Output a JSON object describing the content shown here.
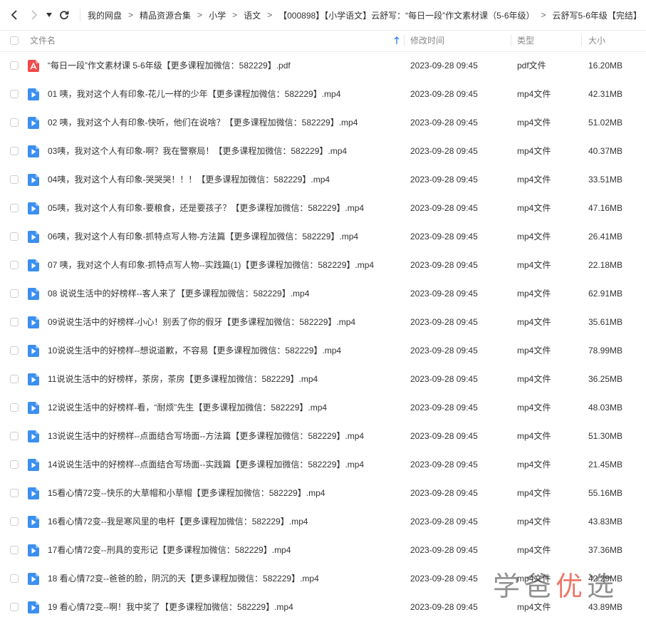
{
  "toolbar": {
    "breadcrumbs": [
      "我的网盘",
      "精品资源合集",
      "小学",
      "语文",
      "【000898】【小学语文】云舒写：“每日一段”作文素材课（5-6年级）",
      "云舒写5-6年级【完结】"
    ],
    "separator": ">"
  },
  "table": {
    "headers": {
      "name": "文件名",
      "modified": "修改时间",
      "type": "类型",
      "size": "大小"
    },
    "rows": [
      {
        "name": "“每日一段”作文素材课 5-6年级【更多课程加微信：582229】.pdf",
        "date": "2023-09-28 09:45",
        "type": "pdf文件",
        "size": "16.20MB",
        "icon": "pdf-icon"
      },
      {
        "name": "01 咦，我对这个人有印象-花儿一样的少年【更多课程加微信：582229】.mp4",
        "date": "2023-09-28 09:45",
        "type": "mp4文件",
        "size": "42.31MB",
        "icon": "video-icon"
      },
      {
        "name": "02 咦，我对这个人有印象-快听，他们在说啥？【更多课程加微信：582229】.mp4",
        "date": "2023-09-28 09:45",
        "type": "mp4文件",
        "size": "51.02MB",
        "icon": "video-icon"
      },
      {
        "name": "03咦，我对这个人有印象-啊？我在警察局！【更多课程加微信：582229】.mp4",
        "date": "2023-09-28 09:45",
        "type": "mp4文件",
        "size": "40.37MB",
        "icon": "video-icon"
      },
      {
        "name": "04咦，我对这个人有印象-哭哭哭！！！【更多课程加微信：582229】.mp4",
        "date": "2023-09-28 09:45",
        "type": "mp4文件",
        "size": "33.51MB",
        "icon": "video-icon"
      },
      {
        "name": "05咦，我对这个人有印象-要粮食，还是要孩子？【更多课程加微信：582229】.mp4",
        "date": "2023-09-28 09:45",
        "type": "mp4文件",
        "size": "47.16MB",
        "icon": "video-icon"
      },
      {
        "name": "06咦，我对这个人有印象-抓特点写人物-方法篇【更多课程加微信：582229】.mp4",
        "date": "2023-09-28 09:45",
        "type": "mp4文件",
        "size": "26.41MB",
        "icon": "video-icon"
      },
      {
        "name": "07 咦，我对这个人有印象-抓特点写人物--实践篇(1)【更多课程加微信：582229】.mp4",
        "date": "2023-09-28 09:45",
        "type": "mp4文件",
        "size": "22.18MB",
        "icon": "video-icon"
      },
      {
        "name": "08 说说生活中的好榜样--客人来了【更多课程加微信：582229】.mp4",
        "date": "2023-09-28 09:45",
        "type": "mp4文件",
        "size": "62.91MB",
        "icon": "video-icon"
      },
      {
        "name": "09说说生活中的好榜样-小心！别丢了你的假牙【更多课程加微信：582229】.mp4",
        "date": "2023-09-28 09:45",
        "type": "mp4文件",
        "size": "35.61MB",
        "icon": "video-icon"
      },
      {
        "name": "10说说生活中的好榜样--想说道歉，不容易【更多课程加微信：582229】.mp4",
        "date": "2023-09-28 09:45",
        "type": "mp4文件",
        "size": "78.99MB",
        "icon": "video-icon"
      },
      {
        "name": "11说说生活中的好榜样，茶房，茶房【更多课程加微信：582229】.mp4",
        "date": "2023-09-28 09:45",
        "type": "mp4文件",
        "size": "36.25MB",
        "icon": "video-icon"
      },
      {
        "name": "12说说生活中的好榜样-看，“耐烦”先生【更多课程加微信：582229】.mp4",
        "date": "2023-09-28 09:45",
        "type": "mp4文件",
        "size": "48.03MB",
        "icon": "video-icon"
      },
      {
        "name": "13说说生活中的好榜样--点面结合写场面--方法篇【更多课程加微信：582229】.mp4",
        "date": "2023-09-28 09:45",
        "type": "mp4文件",
        "size": "51.30MB",
        "icon": "video-icon"
      },
      {
        "name": "14说说生活中的好榜样--点面结合写场面--实践篇【更多课程加微信：582229】.mp4",
        "date": "2023-09-28 09:45",
        "type": "mp4文件",
        "size": "21.45MB",
        "icon": "video-icon"
      },
      {
        "name": "15看心情72变--快乐的大草帽和小草帽【更多课程加微信：582229】.mp4",
        "date": "2023-09-28 09:45",
        "type": "mp4文件",
        "size": "55.16MB",
        "icon": "video-icon"
      },
      {
        "name": "16看心情72变--我是寒风里的电杆【更多课程加微信：582229】.mp4",
        "date": "2023-09-28 09:45",
        "type": "mp4文件",
        "size": "43.83MB",
        "icon": "video-icon"
      },
      {
        "name": "17看心情72变--刑具的变形记【更多课程加微信：582229】.mp4",
        "date": "2023-09-28 09:45",
        "type": "mp4文件",
        "size": "37.36MB",
        "icon": "video-icon"
      },
      {
        "name": "18 看心情72变--爸爸的脸，阴沉的天【更多课程加微信：582229】.mp4",
        "date": "2023-09-28 09:45",
        "type": "mp4文件",
        "size": "42.29MB",
        "icon": "video-icon"
      },
      {
        "name": "19 看心情72变--啊！我中奖了【更多课程加微信：582229】.mp4",
        "date": "2023-09-28 09:45",
        "type": "mp4文件",
        "size": "43.89MB",
        "icon": "video-icon"
      }
    ]
  },
  "watermark": {
    "text_a": "学爸",
    "text_b": "优",
    "text_c": "选"
  },
  "colors": {
    "pdf": "#f04a4a",
    "video": "#3b8ff0",
    "accent": "#3b8ff0"
  }
}
